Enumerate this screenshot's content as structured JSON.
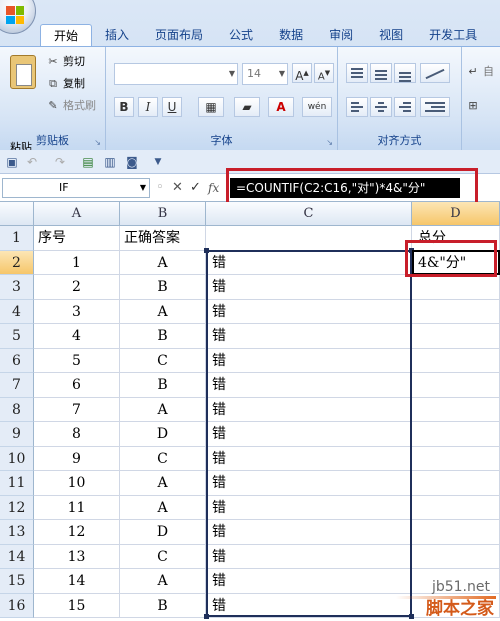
{
  "ribbon": {
    "tabs": [
      "开始",
      "插入",
      "页面布局",
      "公式",
      "数据",
      "审阅",
      "视图",
      "开发工具"
    ],
    "clipboard": {
      "paste": "粘贴",
      "cut": "剪切",
      "copy": "复制",
      "format_painter": "格式刷",
      "group_label": "剪贴板"
    },
    "font": {
      "size": "14",
      "bold": "B",
      "italic": "I",
      "underline": "U",
      "wen": "wén",
      "group_label": "字体"
    },
    "alignment": {
      "group_label": "对齐方式",
      "auto_wrap": "自"
    }
  },
  "formula_bar": {
    "name_box": "IF",
    "fx": "fx",
    "formula": "=COUNTIF(C2:C16,\"对\")*4&\"分\""
  },
  "sheet": {
    "columns": [
      "A",
      "B",
      "C",
      "D"
    ],
    "selected_column": "D",
    "header_row": {
      "a": "序号",
      "b": "正确答案",
      "c": "",
      "d": "总分"
    },
    "rows": [
      {
        "row": "2",
        "a": "1",
        "b": "A",
        "c": "错",
        "d": "4&\"分\""
      },
      {
        "row": "3",
        "a": "2",
        "b": "B",
        "c": "错",
        "d": ""
      },
      {
        "row": "4",
        "a": "3",
        "b": "A",
        "c": "错",
        "d": ""
      },
      {
        "row": "5",
        "a": "4",
        "b": "B",
        "c": "错",
        "d": ""
      },
      {
        "row": "6",
        "a": "5",
        "b": "C",
        "c": "错",
        "d": ""
      },
      {
        "row": "7",
        "a": "6",
        "b": "B",
        "c": "错",
        "d": ""
      },
      {
        "row": "8",
        "a": "7",
        "b": "A",
        "c": "错",
        "d": ""
      },
      {
        "row": "9",
        "a": "8",
        "b": "D",
        "c": "错",
        "d": ""
      },
      {
        "row": "10",
        "a": "9",
        "b": "C",
        "c": "错",
        "d": ""
      },
      {
        "row": "11",
        "a": "10",
        "b": "A",
        "c": "错",
        "d": ""
      },
      {
        "row": "12",
        "a": "11",
        "b": "A",
        "c": "错",
        "d": ""
      },
      {
        "row": "13",
        "a": "12",
        "b": "D",
        "c": "错",
        "d": ""
      },
      {
        "row": "14",
        "a": "13",
        "b": "C",
        "c": "错",
        "d": ""
      },
      {
        "row": "15",
        "a": "14",
        "b": "A",
        "c": "错",
        "d": ""
      },
      {
        "row": "16",
        "a": "15",
        "b": "B",
        "c": "错",
        "d": ""
      }
    ]
  },
  "watermark": {
    "url": "jb51.net",
    "name": "脚本之家"
  },
  "colors": {
    "highlight": "#c81e2a",
    "selection_header": "#f6c66a",
    "ribbon_text": "#15428b"
  }
}
